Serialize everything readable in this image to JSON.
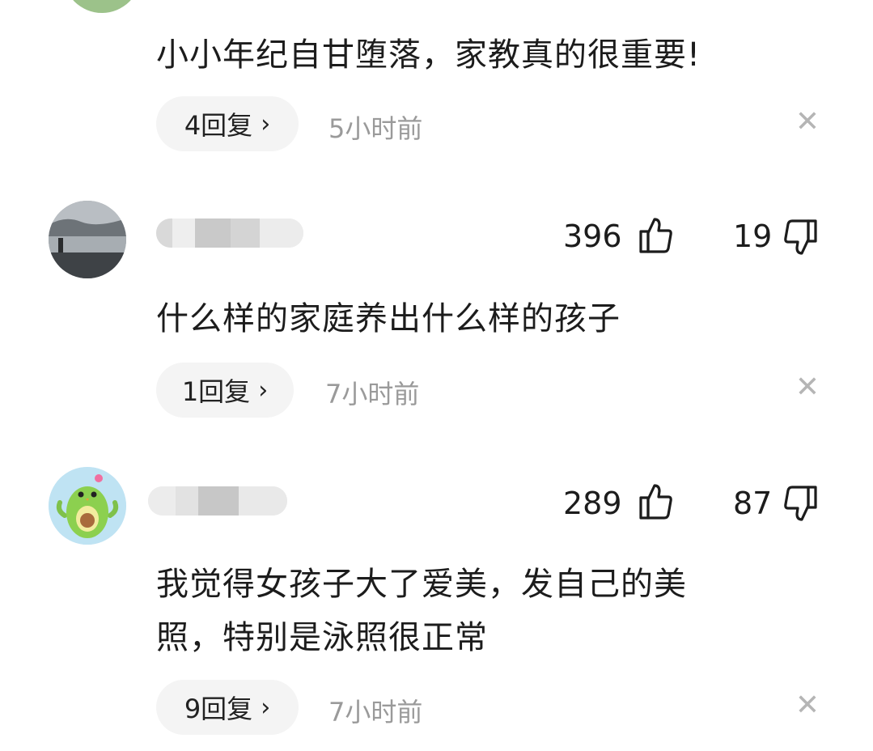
{
  "comments": [
    {
      "text": "小小年纪自甘堕落，家教真的很重要!",
      "replies_label": "4回复",
      "time": "5小时前"
    },
    {
      "likes": "396",
      "dislikes": "19",
      "text": "什么样的家庭养出什么样的孩子",
      "replies_label": "1回复",
      "time": "7小时前"
    },
    {
      "likes": "289",
      "dislikes": "87",
      "text_line1": "我觉得女孩子大了爱美，发自己的美",
      "text_line2": "照，特别是泳照很正常",
      "replies_label": "9回复",
      "time": "7小时前"
    }
  ],
  "icons": {
    "like": "thumbs-up-icon",
    "dislike": "thumbs-down-icon",
    "close": "close-icon",
    "chevron": "chevron-right-icon"
  },
  "colors": {
    "pill_bg": "#f4f4f4",
    "muted_text": "#9a9a9a",
    "close_icon": "#b5b5b5",
    "avocado_avatar_bg": "#bfe3f3"
  }
}
